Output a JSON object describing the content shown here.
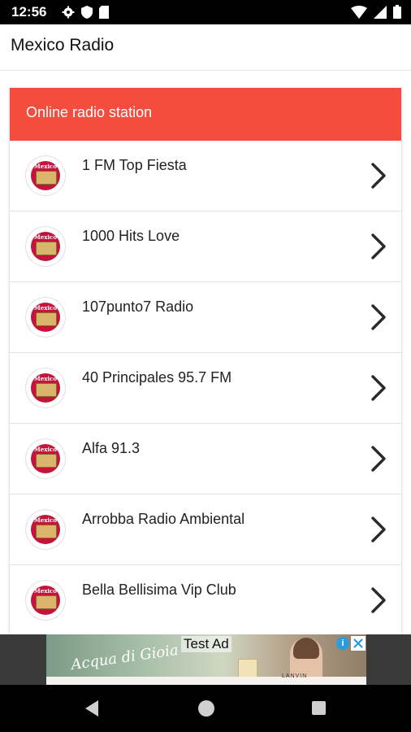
{
  "status_bar": {
    "time": "12:56",
    "icons": [
      "gear-icon",
      "shield-icon",
      "sim-icon",
      "wifi-icon",
      "signal-icon",
      "battery-icon"
    ]
  },
  "app_bar": {
    "title": "Mexico Radio"
  },
  "list": {
    "header": "Online radio station",
    "header_color": "#f44c3f",
    "logo_text": "Mexico",
    "items": [
      {
        "name": "1 FM Top Fiesta"
      },
      {
        "name": "1000 Hits Love"
      },
      {
        "name": "107punto7 Radio"
      },
      {
        "name": "40 Principales 95.7 FM"
      },
      {
        "name": "Alfa 91.3"
      },
      {
        "name": "Arrobba Radio Ambiental"
      },
      {
        "name": "Bella Bellisima Vip Club"
      }
    ]
  },
  "ad": {
    "label": "Test Ad",
    "script_text": "Acqua di Gioia",
    "brand": "LANVIN",
    "info_symbol": "i"
  },
  "nav_bar": {
    "buttons": [
      "back-icon",
      "home-icon",
      "recents-icon"
    ]
  }
}
